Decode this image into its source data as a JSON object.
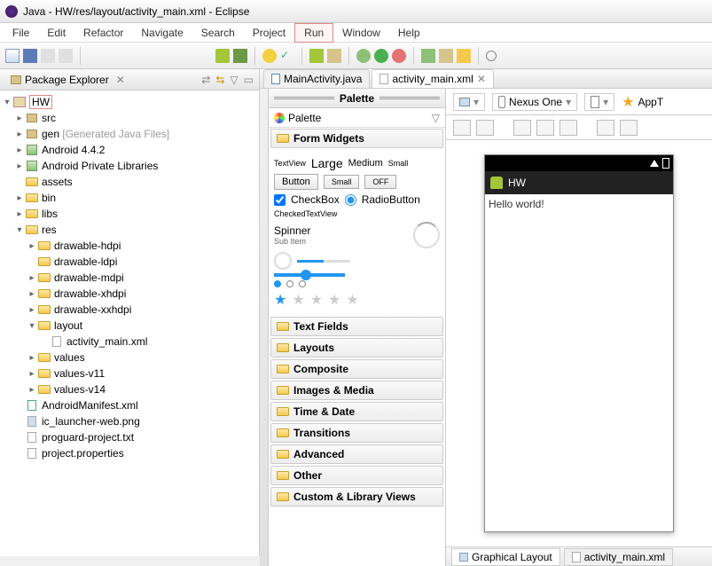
{
  "window": {
    "title": "Java - HW/res/layout/activity_main.xml - Eclipse"
  },
  "menu": {
    "file": "File",
    "edit": "Edit",
    "refactor": "Refactor",
    "navigate": "Navigate",
    "search": "Search",
    "project": "Project",
    "run": "Run",
    "window": "Window",
    "help": "Help"
  },
  "explorer": {
    "title": "Package Explorer",
    "project": "HW",
    "src": "src",
    "gen": "gen",
    "gen_note": "[Generated Java Files]",
    "android": "Android 4.4.2",
    "priv_libs": "Android Private Libraries",
    "assets": "assets",
    "bin": "bin",
    "libs": "libs",
    "res": "res",
    "drawable_hdpi": "drawable-hdpi",
    "drawable_ldpi": "drawable-ldpi",
    "drawable_mdpi": "drawable-mdpi",
    "drawable_xhdpi": "drawable-xhdpi",
    "drawable_xxhdpi": "drawable-xxhdpi",
    "layout": "layout",
    "activity_main": "activity_main.xml",
    "values": "values",
    "values_v11": "values-v11",
    "values_v14": "values-v14",
    "manifest": "AndroidManifest.xml",
    "launcher": "ic_launcher-web.png",
    "proguard": "proguard-project.txt",
    "properties": "project.properties"
  },
  "tabs": {
    "java": "MainActivity.java",
    "xml": "activity_main.xml"
  },
  "palette": {
    "title": "Palette",
    "palette_row": "Palette",
    "form_widgets": "Form Widgets",
    "textview": "TextView",
    "large": "Large",
    "medium": "Medium",
    "small_t": "Small",
    "button": "Button",
    "small": "Small",
    "off": "OFF",
    "checkbox": "CheckBox",
    "radio": "RadioButton",
    "checked_tv": "CheckedTextView",
    "spinner": "Spinner",
    "subitem": "Sub Item",
    "text_fields": "Text Fields",
    "layouts": "Layouts",
    "composite": "Composite",
    "images": "Images & Media",
    "time": "Time & Date",
    "transitions": "Transitions",
    "advanced": "Advanced",
    "other": "Other",
    "custom": "Custom & Library Views"
  },
  "canvas": {
    "device": "Nexus One",
    "appt": "AppT",
    "app_title": "HW",
    "hello": "Hello world!"
  },
  "bottom": {
    "graphical": "Graphical Layout",
    "xml": "activity_main.xml"
  }
}
